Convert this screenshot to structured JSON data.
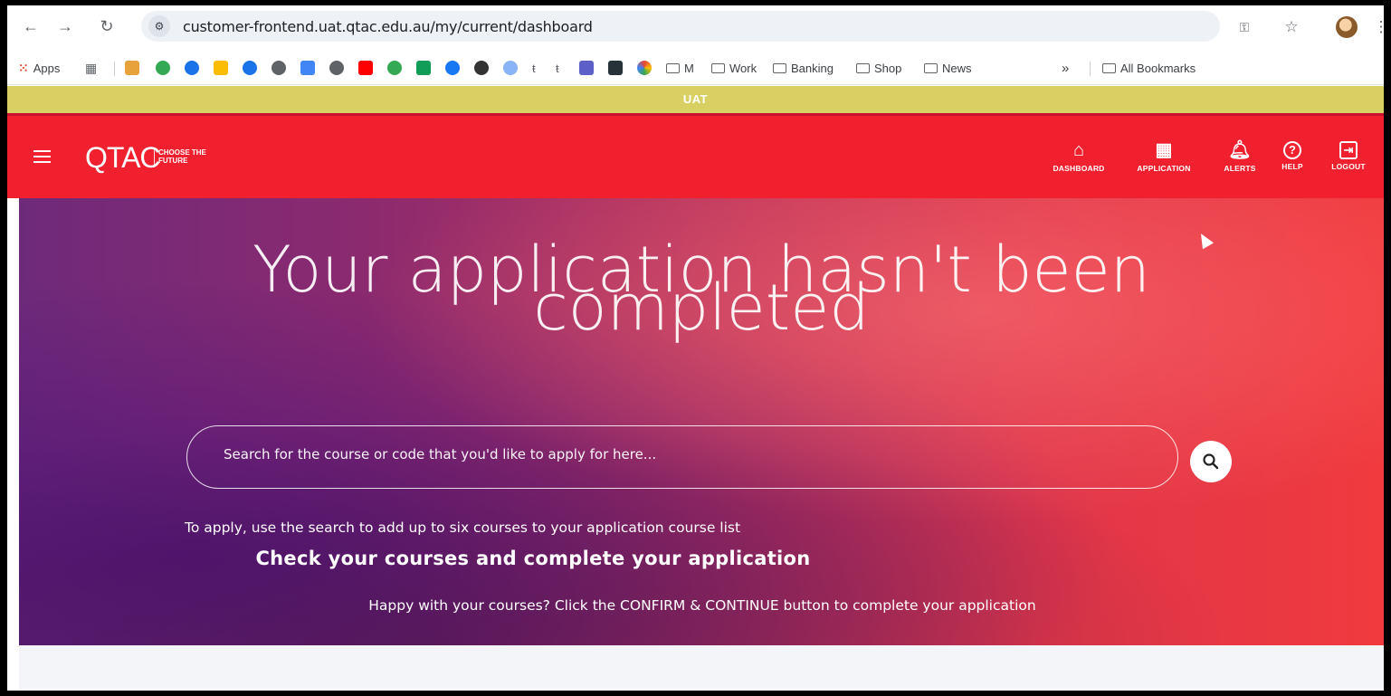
{
  "browser": {
    "url": "customer-frontend.uat.qtac.edu.au/my/current/dashboard",
    "bookmarks": [
      {
        "label": "Apps",
        "icon": "apps-grid-icon"
      },
      {
        "label": "M",
        "icon": "folder-icon"
      },
      {
        "label": "Work",
        "icon": "folder-icon"
      },
      {
        "label": "Banking",
        "icon": "folder-icon"
      },
      {
        "label": "Shop",
        "icon": "folder-icon"
      },
      {
        "label": "News",
        "icon": "folder-icon"
      },
      {
        "label": "All Bookmarks",
        "icon": "folder-icon"
      }
    ],
    "overflow_label": "»"
  },
  "env_banner": "UAT",
  "header": {
    "logo_text": "QTAC",
    "tagline": "CHOOSE THE FUTURE",
    "nav": [
      {
        "label": "DASHBOARD",
        "icon": "home-icon"
      },
      {
        "label": "APPLICATION",
        "icon": "grid-icon"
      },
      {
        "label": "ALERTS",
        "icon": "bell-icon"
      },
      {
        "label": "HELP",
        "icon": "help-icon"
      },
      {
        "label": "LOGOUT",
        "icon": "logout-icon"
      }
    ]
  },
  "hero": {
    "title_line1": "Your application hasn't been",
    "title_line2": "completed",
    "search_placeholder": "Search for the course or code that you'd like to apply for here...",
    "instruction": "To apply, use the search to add up to six courses to your application course list",
    "check_heading": "Check your courses and complete your application",
    "happy_text": "Happy with your courses? Click the CONFIRM & CONTINUE button to complete your application"
  },
  "colors": {
    "header_red": "#f0202f",
    "uat_yellow": "#d9d063",
    "hero_purple": "#6e2a7a",
    "hero_red": "#f03a3e"
  }
}
